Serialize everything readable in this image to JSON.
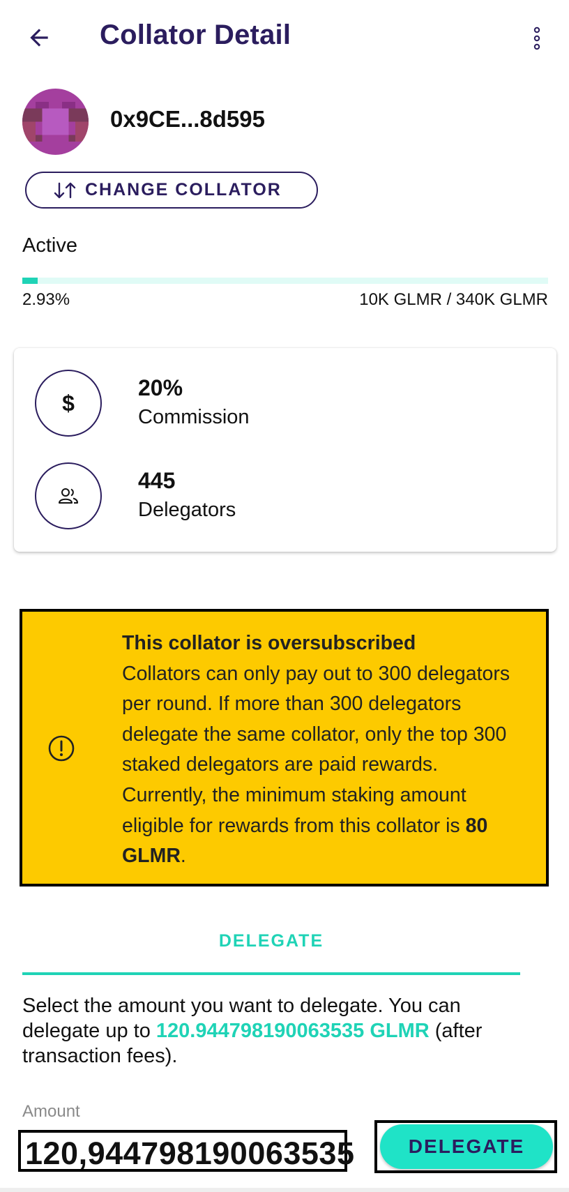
{
  "header": {
    "title": "Collator Detail",
    "back_icon": "arrow-left-icon",
    "more_icon": "more-vert-icon"
  },
  "collator": {
    "address": "0x9CE...8d595",
    "change_button_label": "CHANGE COLLATOR",
    "change_icon": "swap-vertical-icon",
    "status": "Active",
    "progress_fraction": 0.0293,
    "progress_percent_label": "2.93%",
    "stake_label": "10K GLMR / 340K GLMR"
  },
  "stats": {
    "commission": {
      "value": "20%",
      "label": "Commission",
      "symbol": "$"
    },
    "delegators": {
      "value": "445",
      "label": "Delegators",
      "icon": "people-icon"
    }
  },
  "warning": {
    "icon": "alert-circle-icon",
    "heading": "This collator is oversubscribed",
    "body": "Collators can only pay out to 300 delegators per round. If more than 300 delegators delegate the same collator, only the top 300 staked delegators are paid rewards. Currently, the minimum staking amount eligible for rewards from this collator is",
    "min_amount": "80 GLMR",
    "suffix": "."
  },
  "delegate": {
    "tab_label": "DELEGATE",
    "desc_prefix": "Select the amount you want to delegate. You can delegate up to",
    "max_amount": "120.944798190063535 GLMR",
    "desc_suffix": "(after transaction fees).",
    "amount_label": "Amount",
    "amount_value": "120,944798190063535",
    "button_label": "DELEGATE"
  },
  "colors": {
    "primary": "#2b1d5e",
    "accent": "#1fd3b6",
    "warning_bg": "#fdca00"
  }
}
